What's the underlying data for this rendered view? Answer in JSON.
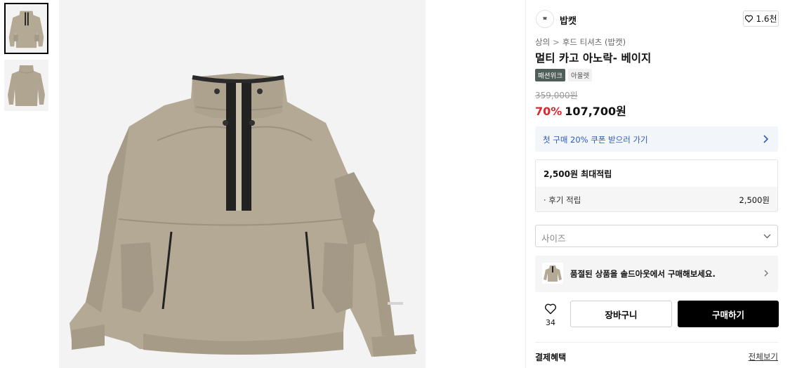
{
  "gallery": {
    "thumbnails": [
      {
        "alt": "product-front",
        "active": true
      },
      {
        "alt": "product-back",
        "active": false
      }
    ]
  },
  "brand": {
    "logo_text": "W Babcat",
    "name": "밥캣",
    "like_count": "1.6천"
  },
  "breadcrumb": {
    "items": [
      "상의",
      "후드 티셔츠 (밥캣)"
    ],
    "separator": ">"
  },
  "product": {
    "title": "멀티 카고 아노락- 베이지",
    "badges": [
      "패션위크",
      "아울렛"
    ],
    "original_price": "359,000원",
    "discount": "70%",
    "sale_price": "107,700원"
  },
  "coupon": {
    "text": "첫 구매 20% 쿠폰 받으러 가기"
  },
  "points": {
    "header": "2,500원 최대적립",
    "review_label": "· 후기 적립",
    "review_value": "2,500원"
  },
  "size_select": {
    "placeholder": "사이즈"
  },
  "soldout": {
    "text": "품절된 상품을 솔드아웃에서 구매해보세요."
  },
  "actions": {
    "wish_count": "34",
    "cart_label": "장바구니",
    "buy_label": "구매하기"
  },
  "payment": {
    "label": "결제혜택",
    "view_all": "전체보기"
  },
  "colors": {
    "discount_red": "#e0262f",
    "coupon_blue": "#2c5bbf",
    "badge_green": "#4f5e58",
    "product_beige": "#b4a995"
  }
}
